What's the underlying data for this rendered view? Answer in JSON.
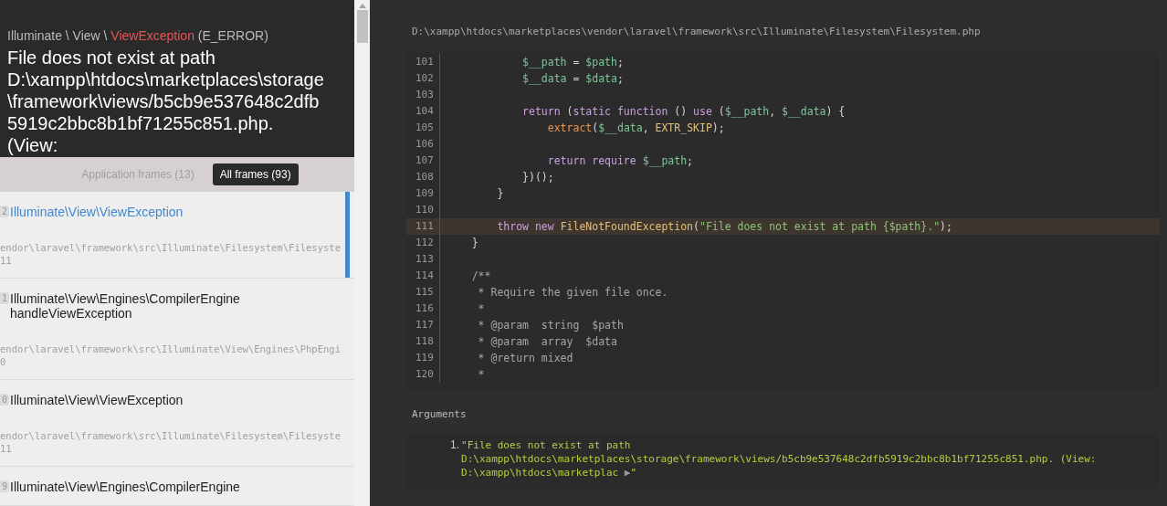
{
  "exception": {
    "namespace": "Illuminate \\ View \\",
    "class": "ViewException",
    "level": "(E_ERROR)",
    "message": "File does not exist at path D:\\xampp\\htdocs\\marketplaces\\storage\\framework\\views/b5cb9e537648c2dfb5919c2bbc8b1bf71255c851.php. (View:"
  },
  "frame_tabs": [
    {
      "label": "Application frames (13)",
      "selected": false
    },
    {
      "label": "All frames (93)",
      "selected": true
    }
  ],
  "frames": [
    {
      "number": "2",
      "class": "Illuminate\\View\\ViewException",
      "path": "endor\\laravel\\framework\\src\\Illuminate\\Filesystem\\Filesyste",
      "line": "11",
      "selected": true
    },
    {
      "number": "1",
      "class": "Illuminate\\View\\Engines\\CompilerEngine",
      "method": "handleViewException",
      "path": "endor\\laravel\\framework\\src\\Illuminate\\View\\Engines\\PhpEngi",
      "line": "0",
      "selected": false
    },
    {
      "number": "0",
      "class": "Illuminate\\View\\ViewException",
      "path": "endor\\laravel\\framework\\src\\Illuminate\\Filesystem\\Filesyste",
      "line": "11",
      "selected": false
    },
    {
      "number": "9",
      "class": "Illuminate\\View\\Engines\\CompilerEngine",
      "selected": false
    }
  ],
  "code": {
    "file": "D:\\xampp\\htdocs\\marketplaces\\vendor\\laravel\\framework\\src\\Illuminate\\Filesystem\\Filesystem.php",
    "lines": [
      {
        "no": "101",
        "highlighted": false,
        "tokens": [
          {
            "kind": "var",
            "text": "            $__path"
          },
          {
            "kind": "plain",
            "text": " = "
          },
          {
            "kind": "var",
            "text": "$path"
          },
          {
            "kind": "plain",
            "text": ";"
          }
        ]
      },
      {
        "no": "102",
        "highlighted": false,
        "tokens": [
          {
            "kind": "var",
            "text": "            $__data"
          },
          {
            "kind": "plain",
            "text": " = "
          },
          {
            "kind": "var",
            "text": "$data"
          },
          {
            "kind": "plain",
            "text": ";"
          }
        ]
      },
      {
        "no": "103",
        "highlighted": false
      },
      {
        "no": "104",
        "highlighted": false,
        "tokens": [
          {
            "kind": "keyword",
            "text": "            return"
          },
          {
            "kind": "plain",
            "text": " ("
          },
          {
            "kind": "keyword",
            "text": "static function"
          },
          {
            "kind": "plain",
            "text": " () "
          },
          {
            "kind": "keyword",
            "text": "use"
          },
          {
            "kind": "plain",
            "text": " ("
          },
          {
            "kind": "var",
            "text": "$__path"
          },
          {
            "kind": "plain",
            "text": ", "
          },
          {
            "kind": "var",
            "text": "$__data"
          },
          {
            "kind": "plain",
            "text": ") {"
          }
        ]
      },
      {
        "no": "105",
        "highlighted": false,
        "tokens": [
          {
            "kind": "func",
            "text": "                extract"
          },
          {
            "kind": "plain",
            "text": "("
          },
          {
            "kind": "var",
            "text": "$__data"
          },
          {
            "kind": "plain",
            "text": ", "
          },
          {
            "kind": "const",
            "text": "EXTR_SKIP"
          },
          {
            "kind": "plain",
            "text": ");"
          }
        ]
      },
      {
        "no": "106",
        "highlighted": false
      },
      {
        "no": "107",
        "highlighted": false,
        "tokens": [
          {
            "kind": "keyword",
            "text": "                return require"
          },
          {
            "kind": "var",
            "text": " $__path"
          },
          {
            "kind": "plain",
            "text": ";"
          }
        ]
      },
      {
        "no": "108",
        "highlighted": false,
        "tokens": [
          {
            "kind": "plain",
            "text": "            })();"
          }
        ]
      },
      {
        "no": "109",
        "highlighted": false,
        "tokens": [
          {
            "kind": "plain",
            "text": "        }"
          }
        ]
      },
      {
        "no": "110",
        "highlighted": false
      },
      {
        "no": "111",
        "highlighted": true,
        "tokens": [
          {
            "kind": "keyword",
            "text": "        throw new"
          },
          {
            "kind": "const",
            "text": " FileNotFoundException"
          },
          {
            "kind": "plain",
            "text": "("
          },
          {
            "kind": "string",
            "text": "\"File does not exist at path {$path}.\""
          },
          {
            "kind": "plain",
            "text": ");"
          }
        ]
      },
      {
        "no": "112",
        "highlighted": false,
        "tokens": [
          {
            "kind": "plain",
            "text": "    }"
          }
        ]
      },
      {
        "no": "113",
        "highlighted": false
      },
      {
        "no": "114",
        "highlighted": false,
        "tokens": [
          {
            "kind": "comment",
            "text": "    /**"
          }
        ]
      },
      {
        "no": "115",
        "highlighted": false,
        "tokens": [
          {
            "kind": "comment",
            "text": "     * Require the given file once."
          }
        ]
      },
      {
        "no": "116",
        "highlighted": false,
        "tokens": [
          {
            "kind": "comment",
            "text": "     *"
          }
        ]
      },
      {
        "no": "117",
        "highlighted": false,
        "tokens": [
          {
            "kind": "comment",
            "text": "     * @param  string  $path"
          }
        ]
      },
      {
        "no": "118",
        "highlighted": false,
        "tokens": [
          {
            "kind": "comment",
            "text": "     * @param  array  $data"
          }
        ]
      },
      {
        "no": "119",
        "highlighted": false,
        "tokens": [
          {
            "kind": "comment",
            "text": "     * @return mixed"
          }
        ]
      },
      {
        "no": "120",
        "highlighted": false,
        "tokens": [
          {
            "kind": "comment",
            "text": "     *"
          }
        ]
      }
    ]
  },
  "arguments": {
    "title": "Arguments",
    "items": [
      {
        "index": "1.",
        "lines": [
          "\"File does not exist at path",
          "D:\\xampp\\htdocs\\marketplaces\\storage\\framework\\views/b5cb9e537648c2dfb5919c2bbc8b1bf71255c851.php. (View:",
          "D:\\xampp\\htdocs\\marketplac"
        ],
        "expand": "▶",
        "close": "\""
      }
    ]
  }
}
